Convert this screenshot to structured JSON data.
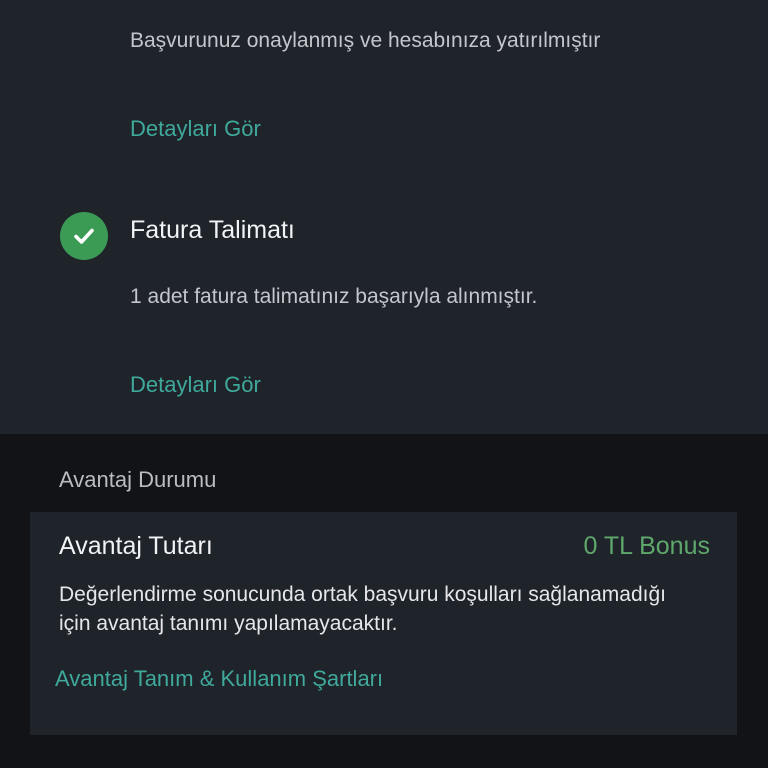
{
  "application_step": {
    "message": "Başvurunuz onaylanmış ve hesabınıza yatırılmıştır",
    "details_link": "Detayları Gör"
  },
  "invoice_step": {
    "title": "Fatura Talimatı",
    "status_icon": "check-icon",
    "status_color": "#3b9b55",
    "message": "1 adet fatura talimatınız başarıyla alınmıştır.",
    "details_link": "Detayları Gör"
  },
  "advantage": {
    "section_label": "Avantaj Durumu",
    "title": "Avantaj Tutarı",
    "value": "0 TL Bonus",
    "description": "Değerlendirme sonucunda ortak başvuru koşulları sağlanamadığı için avantaj tanımı yapılamayacaktır.",
    "terms_link": "Avantaj Tanım & Kullanım Şartları"
  },
  "colors": {
    "link": "#3fa99b",
    "bonus": "#5fa86c",
    "card_bg": "#1f232a",
    "page_bg": "#111316"
  }
}
